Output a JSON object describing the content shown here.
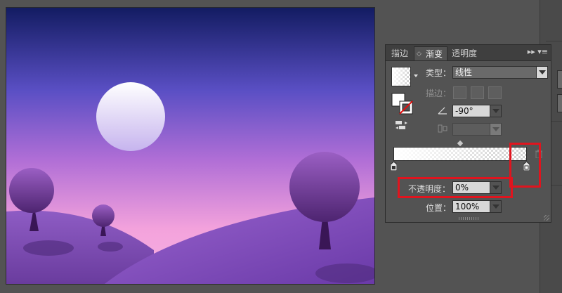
{
  "panel": {
    "tabs": [
      {
        "label": "描边",
        "active": false
      },
      {
        "label": "渐变",
        "active": true
      },
      {
        "label": "透明度",
        "active": false
      }
    ],
    "menu_glyph": "▸▸ ▾≡",
    "type_label": "类型：",
    "type_value": "线性",
    "stroke_label": "描边：",
    "angle_value": "-90°",
    "aspect_value": "",
    "opacity_label": "不透明度：",
    "opacity_value": "0%",
    "location_label": "位置：",
    "location_value": "100%"
  },
  "icons": {
    "gradient_swatch": "gradient-swatch-icon",
    "fill_stroke": "fill-stroke-icon",
    "reverse_gradient": "reverse-gradient-icon",
    "angle": "angle-icon",
    "aspect_ratio": "aspect-ratio-icon",
    "delete_stop": "trash-icon"
  },
  "colors": {
    "highlight_box": "#e0141e",
    "panel_bg": "#535353",
    "sky_top": "#151f66",
    "sky_mid": "#5a4dc0",
    "sky_bottom": "#f2a0dc",
    "hill": "#7a4aae"
  }
}
